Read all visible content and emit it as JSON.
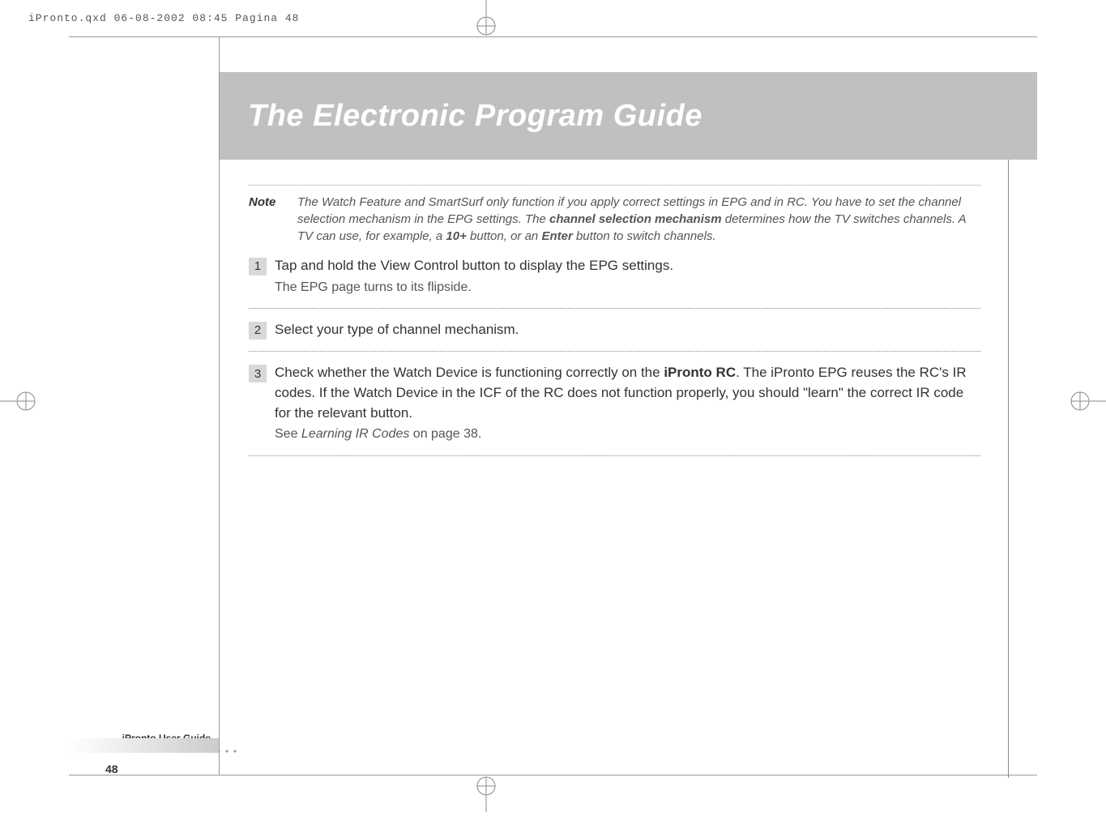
{
  "print": {
    "header": "iPronto.qxd  06-08-2002  08:45  Pagina 48"
  },
  "title": "The Electronic Program Guide",
  "note": {
    "label": "Note",
    "text_parts": {
      "p1": "The Watch Feature and SmartSurf only function if you apply correct settings in EPG and in RC. You have to set the channel selection mechanism in the EPG settings. The ",
      "bold1": "channel selection mechanism",
      "p2": " determines how the TV switches channels. A TV can use, for example, a ",
      "bold2": "10+",
      "p3": " button, or an ",
      "bold3": "Enter",
      "p4": " button to switch channels."
    }
  },
  "steps": [
    {
      "num": "1",
      "main": "Tap and hold the View Control button to display the EPG settings.",
      "sub": "The EPG page turns to its flipside."
    },
    {
      "num": "2",
      "main": "Select your type of channel mechanism."
    },
    {
      "num": "3",
      "main_parts": {
        "p1": "Check whether the Watch Device is functioning correctly on the ",
        "bold1": "iPronto RC",
        "p2": ". The iPronto EPG reuses the RC's IR codes. If the Watch Device in the ICF of the RC does not function properly, you should \"learn\" the correct IR code for the relevant button."
      },
      "sub_parts": {
        "p1": "See ",
        "italic1": "Learning IR Codes",
        "p2": " on page 38."
      }
    }
  ],
  "footer": {
    "brand": "iPronto",
    "label": "User Guide",
    "page": "48"
  }
}
